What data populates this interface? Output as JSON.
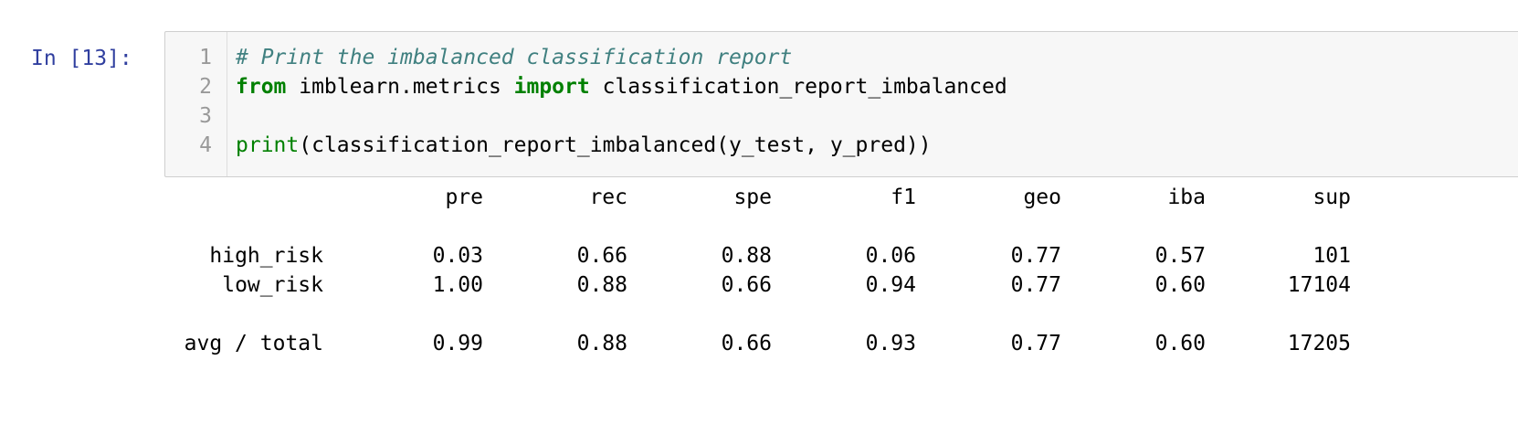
{
  "cell": {
    "prompt": "In [13]:",
    "lines": [
      {
        "number": "1",
        "tokens": [
          {
            "text": "# Print the imbalanced classification report",
            "kind": "comment"
          }
        ]
      },
      {
        "number": "2",
        "tokens": [
          {
            "text": "from",
            "kind": "keyword"
          },
          {
            "text": " imblearn.metrics ",
            "kind": "plain"
          },
          {
            "text": "import",
            "kind": "keyword"
          },
          {
            "text": " classification_report_imbalanced",
            "kind": "plain"
          }
        ]
      },
      {
        "number": "3",
        "tokens": []
      },
      {
        "number": "4",
        "tokens": [
          {
            "text": "print",
            "kind": "builtin"
          },
          {
            "text": "(classification_report_imbalanced(y_test, y_pred))",
            "kind": "plain"
          }
        ]
      }
    ]
  },
  "output": {
    "headers": [
      "pre",
      "rec",
      "spe",
      "f1",
      "geo",
      "iba",
      "sup"
    ],
    "rows": [
      {
        "label": "high_risk",
        "values": [
          "0.03",
          "0.66",
          "0.88",
          "0.06",
          "0.77",
          "0.57",
          "101"
        ]
      },
      {
        "label": "low_risk",
        "values": [
          "1.00",
          "0.88",
          "0.66",
          "0.94",
          "0.77",
          "0.60",
          "17104"
        ]
      }
    ],
    "total": {
      "label": "avg / total",
      "values": [
        "0.99",
        "0.88",
        "0.66",
        "0.93",
        "0.77",
        "0.60",
        "17205"
      ]
    }
  },
  "colors": {
    "prompt": "#303f9f",
    "comment": "#408080",
    "keyword": "#008000",
    "editor_bg": "#f7f7f7",
    "editor_border": "#cfcfcf",
    "line_number": "#999999"
  }
}
